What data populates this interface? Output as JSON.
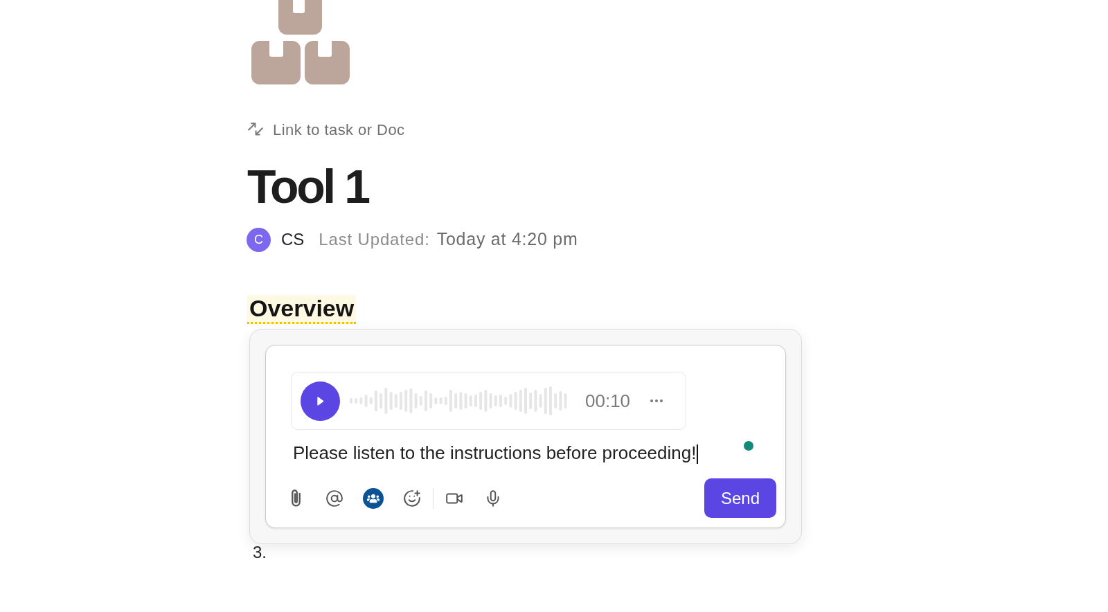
{
  "doc": {
    "link_button": "Link to task or Doc",
    "title": "Tool 1",
    "meta": {
      "avatar": "C",
      "author": "CS",
      "updated_label": "Last Updated:",
      "updated_value": "Today at 4:20 pm"
    },
    "heading": {
      "text": "Overview",
      "highlighted": true
    },
    "comment_composer": {
      "voice_message": {
        "duration": "00:10"
      },
      "message": "Please listen to the instructions before proceeding!",
      "tool_groups": [
        [
          {
            "kind": "attach",
            "selected": false
          },
          {
            "kind": "mention",
            "selected": false
          },
          {
            "kind": "team",
            "selected": true
          },
          {
            "kind": "emoji",
            "selected": false
          }
        ],
        [
          {
            "kind": "video",
            "selected": false
          },
          {
            "kind": "voice",
            "selected": false
          }
        ]
      ],
      "send_button": "Send"
    },
    "list_marker": "3."
  }
}
